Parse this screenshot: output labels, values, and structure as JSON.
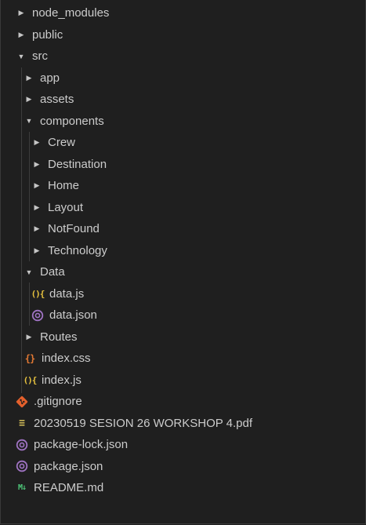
{
  "explorer": {
    "items": [
      {
        "label": "node_modules",
        "type": "folder",
        "expanded": false,
        "depth": 0,
        "icon": "chevron-right-icon"
      },
      {
        "label": "public",
        "type": "folder",
        "expanded": false,
        "depth": 0,
        "icon": "chevron-right-icon"
      },
      {
        "label": "src",
        "type": "folder",
        "expanded": true,
        "depth": 0,
        "icon": "chevron-down-icon"
      },
      {
        "label": "app",
        "type": "folder",
        "expanded": false,
        "depth": 1,
        "icon": "chevron-right-icon"
      },
      {
        "label": "assets",
        "type": "folder",
        "expanded": false,
        "depth": 1,
        "icon": "chevron-right-icon"
      },
      {
        "label": "components",
        "type": "folder",
        "expanded": true,
        "depth": 1,
        "icon": "chevron-down-icon"
      },
      {
        "label": "Crew",
        "type": "folder",
        "expanded": false,
        "depth": 2,
        "icon": "chevron-right-icon"
      },
      {
        "label": "Destination",
        "type": "folder",
        "expanded": false,
        "depth": 2,
        "icon": "chevron-right-icon"
      },
      {
        "label": "Home",
        "type": "folder",
        "expanded": false,
        "depth": 2,
        "icon": "chevron-right-icon"
      },
      {
        "label": "Layout",
        "type": "folder",
        "expanded": false,
        "depth": 2,
        "icon": "chevron-right-icon"
      },
      {
        "label": "NotFound",
        "type": "folder",
        "expanded": false,
        "depth": 2,
        "icon": "chevron-right-icon"
      },
      {
        "label": "Technology",
        "type": "folder",
        "expanded": false,
        "depth": 2,
        "icon": "chevron-right-icon"
      },
      {
        "label": "Data",
        "type": "folder",
        "expanded": true,
        "depth": 1,
        "icon": "chevron-down-icon"
      },
      {
        "label": "data.js",
        "type": "file",
        "depth": 2,
        "icon": "javascript-file-icon"
      },
      {
        "label": "data.json",
        "type": "file",
        "depth": 2,
        "icon": "json-file-icon"
      },
      {
        "label": "Routes",
        "type": "folder",
        "expanded": false,
        "depth": 1,
        "icon": "chevron-right-icon"
      },
      {
        "label": "index.css",
        "type": "file",
        "depth": 1,
        "icon": "css-file-icon"
      },
      {
        "label": "index.js",
        "type": "file",
        "depth": 1,
        "icon": "javascript-file-icon"
      },
      {
        "label": ".gitignore",
        "type": "file",
        "depth": 0,
        "icon": "git-file-icon"
      },
      {
        "label": "20230519 SESION 26 WORKSHOP 4.pdf",
        "type": "file",
        "depth": 0,
        "icon": "pdf-file-icon"
      },
      {
        "label": "package-lock.json",
        "type": "file",
        "depth": 0,
        "icon": "json-file-icon"
      },
      {
        "label": "package.json",
        "type": "file",
        "depth": 0,
        "icon": "json-file-icon"
      },
      {
        "label": "README.md",
        "type": "file",
        "depth": 0,
        "icon": "markdown-file-icon"
      }
    ]
  },
  "colors": {
    "background": "#1f1f1f",
    "text": "#cccccc",
    "indent_guide": "#3c3c3c",
    "js": "#e8c33f",
    "css": "#e37933",
    "json": "#a074c4",
    "git": "#e4602c",
    "markdown": "#4ec97a"
  }
}
